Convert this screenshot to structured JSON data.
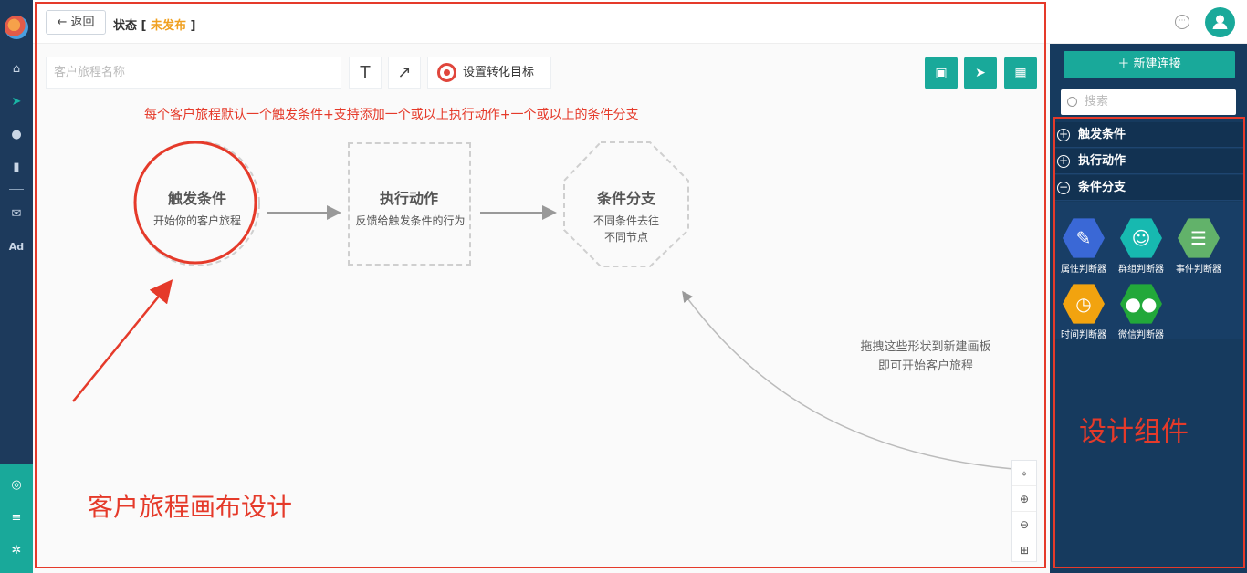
{
  "header": {
    "back_label": "返回",
    "status_label": "状态",
    "status_value": "未发布"
  },
  "canvas": {
    "name_placeholder": "客户旅程名称",
    "text_tool_glyph": "T",
    "arrow_tool_glyph": "↗",
    "goal_label": "设置转化目标",
    "note": "每个客户旅程默认一个触发条件+支持添加一个或以上执行动作+一个或以上的条件分支",
    "nodes": {
      "trigger": {
        "title": "触发条件",
        "subtitle": "开始你的客户旅程"
      },
      "action": {
        "title": "执行动作",
        "subtitle": "反馈给触发条件的行为"
      },
      "branch": {
        "title": "条件分支",
        "subtitle_line1": "不同条件去往",
        "subtitle_line2": "不同节点"
      }
    },
    "hint_line1": "拖拽这些形状到新建画板",
    "hint_line2": "即可开始客户旅程",
    "annotation": "客户旅程画布设计"
  },
  "right_panel": {
    "new_connection": "新建连接",
    "search_placeholder": "搜索",
    "sections": [
      {
        "label": "触发条件",
        "expanded": false
      },
      {
        "label": "执行动作",
        "expanded": false
      },
      {
        "label": "条件分支",
        "expanded": true
      }
    ],
    "components": [
      {
        "label": "属性判断器",
        "icon": "edit-icon",
        "color": "#3a68d6"
      },
      {
        "label": "群组判断器",
        "icon": "user-group-icon",
        "color": "#17b9b0"
      },
      {
        "label": "事件判断器",
        "icon": "list-icon",
        "color": "#62b26a"
      },
      {
        "label": "时间判断器",
        "icon": "clock-icon",
        "color": "#f2a30f"
      },
      {
        "label": "微信判断器",
        "icon": "wechat-icon",
        "color": "#22a83a"
      }
    ],
    "annotation": "设计组件"
  },
  "colors": {
    "accent": "#19a99a",
    "nav_bg": "#1d3a5c",
    "panel_bg": "#163a5e",
    "annotation_red": "#e53a2a",
    "status_orange": "#f0a020"
  }
}
